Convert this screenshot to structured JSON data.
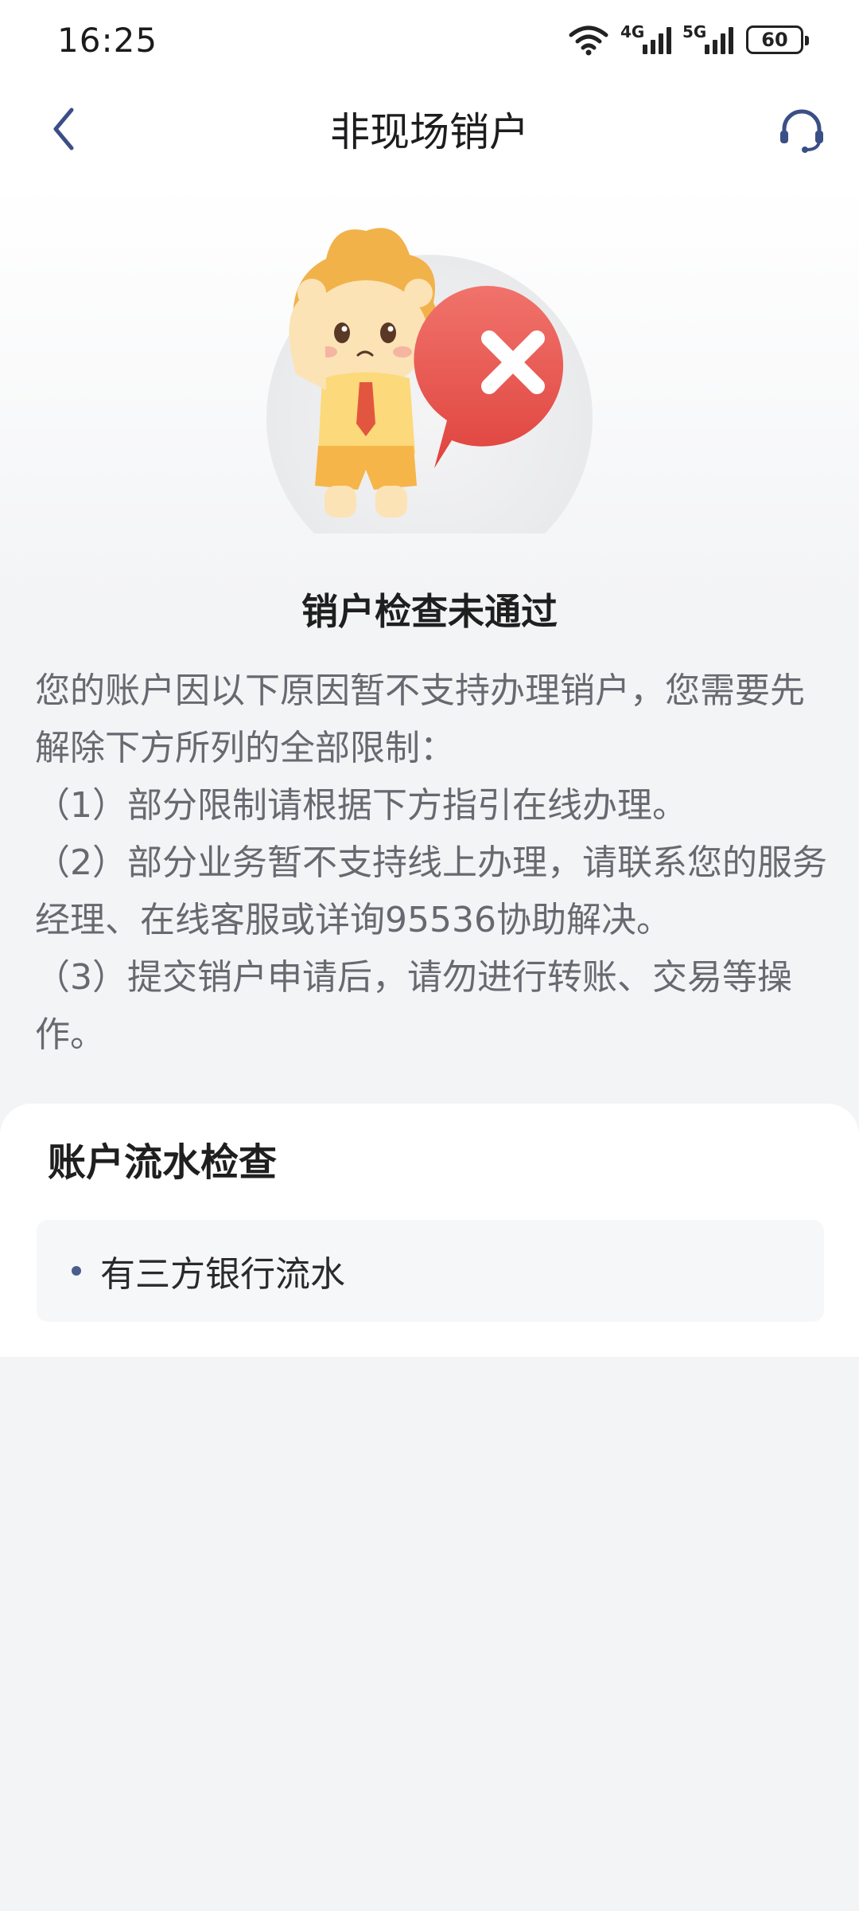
{
  "status_bar": {
    "time": "16:25",
    "signal_1_label": "4G",
    "signal_2_label": "5G",
    "battery": "60"
  },
  "nav": {
    "title": "非现场销户",
    "back_icon": "chevron-left-icon",
    "service_icon": "headset-icon"
  },
  "result": {
    "title": "销户检查未通过",
    "description": [
      "您的账户因以下原因暂不支持办理销户，您需要先解除下方所列的全部限制：",
      "（1）部分限制请根据下方指引在线办理。",
      "（2）部分业务暂不支持线上办理，请联系您的服务经理、在线客服或详询95536协助解决。",
      "（3）提交销户申请后，请勿进行转账、交易等操作。"
    ]
  },
  "check_card": {
    "title": "账户流水检查",
    "items": [
      "有三方银行流水"
    ]
  },
  "colors": {
    "accent": "#3a4f86",
    "error": "#e8504a"
  }
}
